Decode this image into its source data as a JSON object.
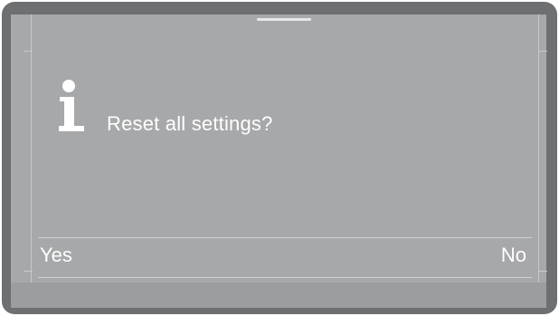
{
  "dialog": {
    "message": "Reset all settings?",
    "icon": "info-icon"
  },
  "softkeys": {
    "yes_label": "Yes",
    "no_label": "No"
  },
  "colors": {
    "bezel": "#6e6f71",
    "screen": "#a7a8aa",
    "text": "#ffffff"
  }
}
